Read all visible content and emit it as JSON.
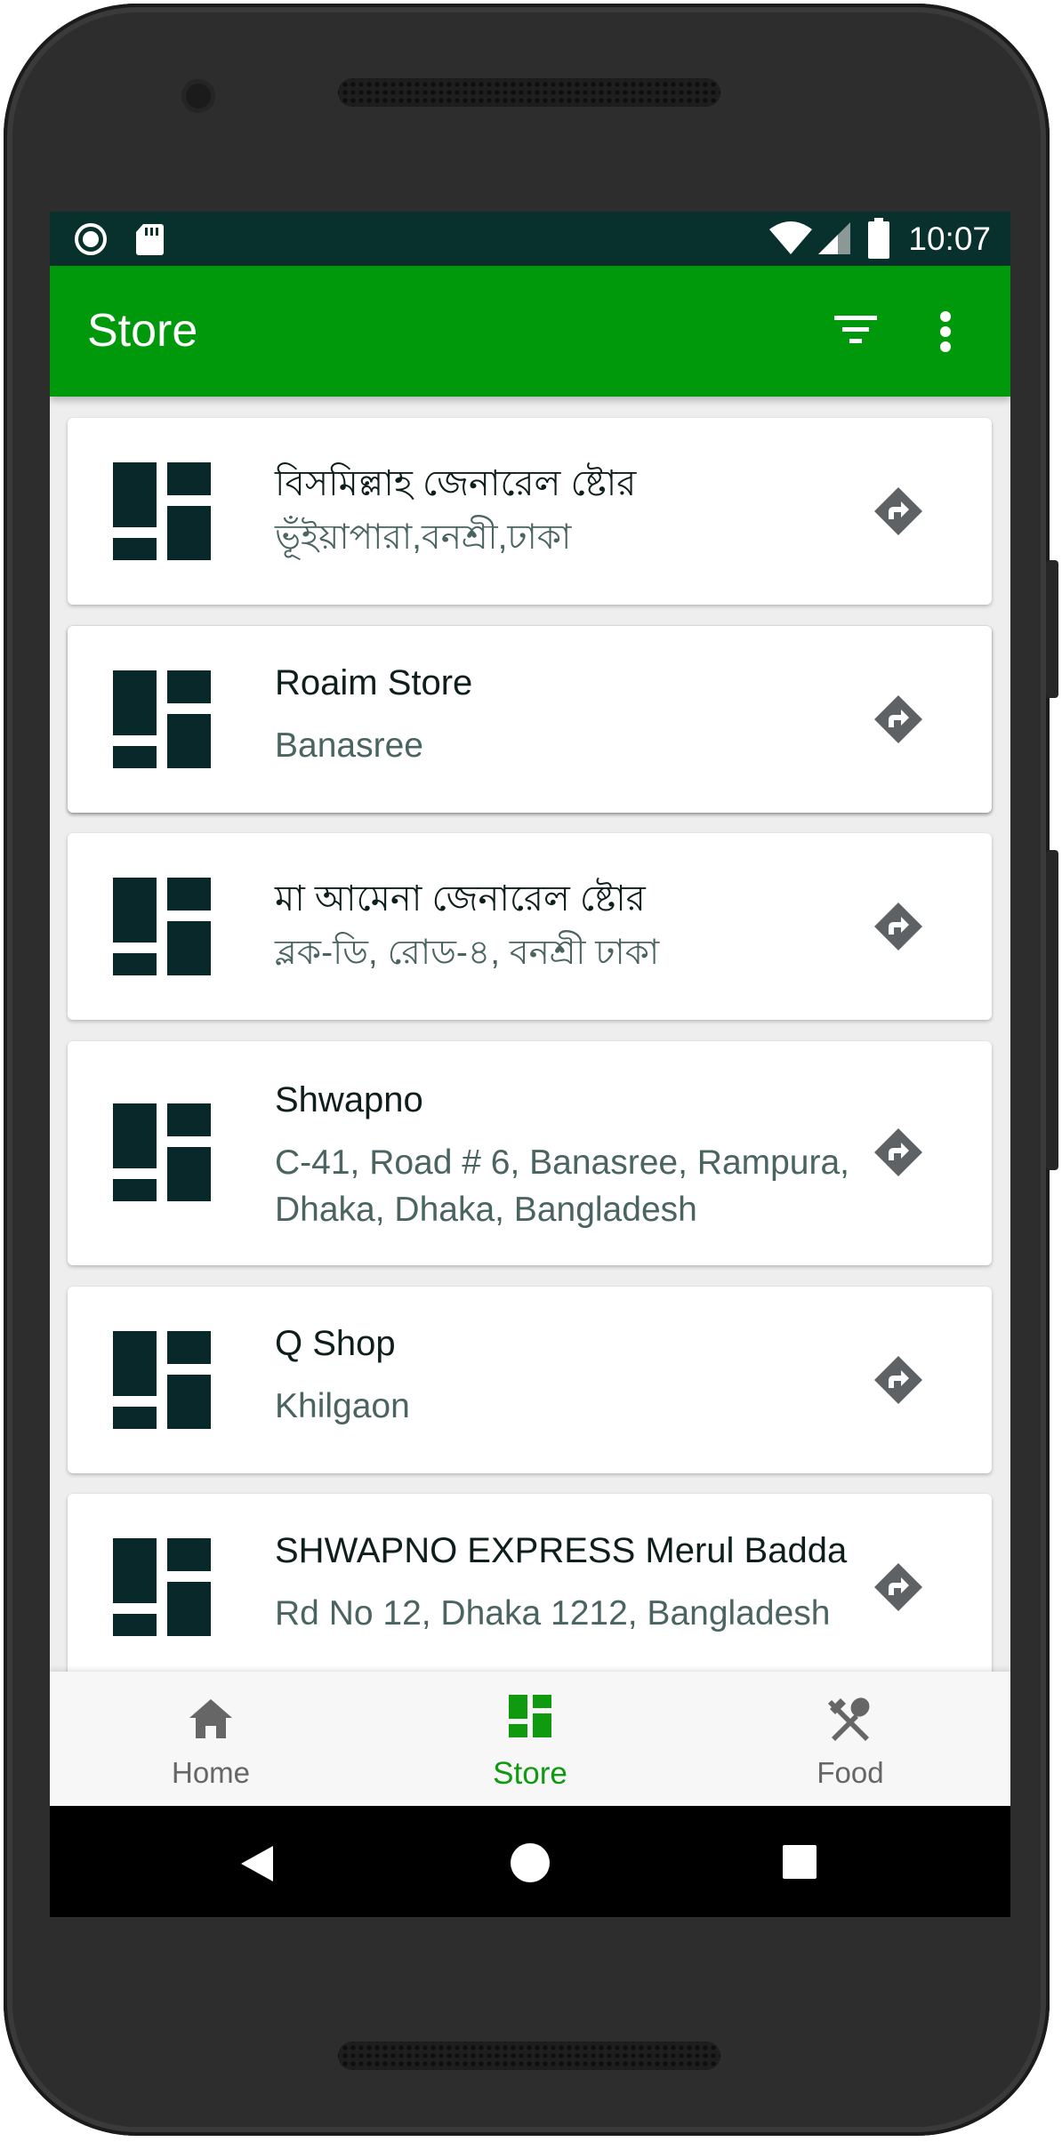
{
  "status_bar": {
    "time": "10:07",
    "left_icons": [
      "sync-icon",
      "sd-card-icon"
    ],
    "right_icons": [
      "wifi-icon",
      "signal-icon",
      "battery-icon"
    ]
  },
  "app_bar": {
    "title": "Store",
    "actions": [
      "filter-icon",
      "more-vert-icon"
    ]
  },
  "stores": [
    {
      "name": "বিসমিল্লাহ জেনারেল ষ্টোর",
      "address": "ভূঁইয়াপারা,বনশ্রী,ঢাকা"
    },
    {
      "name": "Roaim Store",
      "address": "Banasree"
    },
    {
      "name": "মা আমেনা জেনারেল ষ্টোর",
      "address": "ব্লক-ডি, রোড-৪, বনশ্রী ঢাকা"
    },
    {
      "name": "Shwapno",
      "address": "C-41, Road # 6, Banasree, Rampura, Dhaka, Dhaka, Bangladesh"
    },
    {
      "name": "Q Shop",
      "address": "Khilgaon"
    },
    {
      "name": "SHWAPNO EXPRESS Merul Badda",
      "address": "Rd No 12, Dhaka 1212, Bangladesh"
    }
  ],
  "bottom_nav": [
    {
      "label": "Home",
      "icon": "home-icon",
      "active": false
    },
    {
      "label": "Store",
      "icon": "dashboard-icon",
      "active": true
    },
    {
      "label": "Food",
      "icon": "restaurant-icon",
      "active": false
    }
  ],
  "system_nav": [
    "back-icon",
    "home-circle-icon",
    "recents-icon"
  ],
  "colors": {
    "app_bar": "#00990b",
    "status_bar": "#08302c",
    "active_nav": "#0f9a10",
    "inactive_nav": "#666666",
    "store_logo": "#08282a",
    "store_name": "#0e1e1c",
    "store_address": "#4a6462"
  }
}
